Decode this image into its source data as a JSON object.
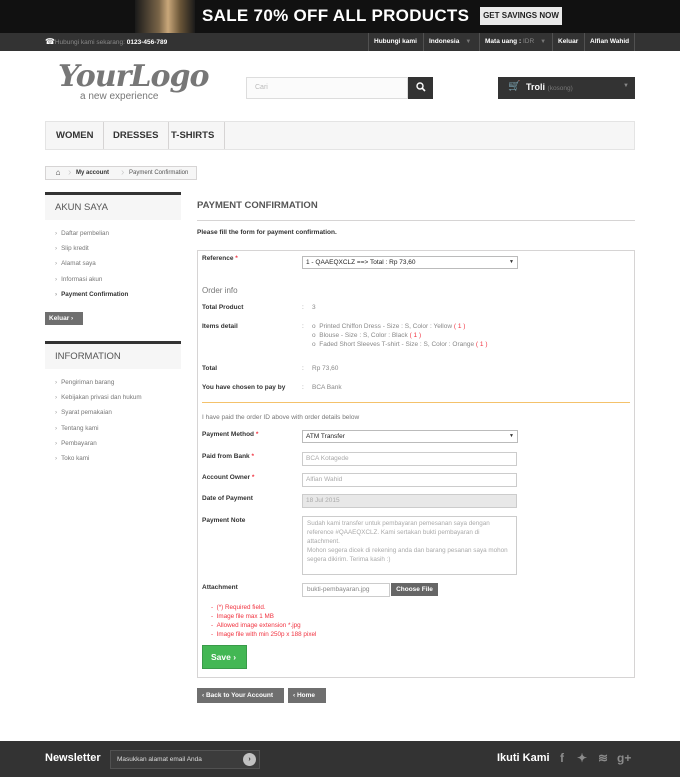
{
  "banner": {
    "sale_text": "SALE 70% OFF ALL PRODUCTS",
    "cta_label": "GET SAVINGS NOW"
  },
  "topbar": {
    "phone_label": "Hubungi kami sekarang:",
    "phone_number": "0123-456-789",
    "contact_link": "Hubungi kami",
    "language": "Indonesia",
    "currency_label": "Mata uang :",
    "currency_value": "IDR",
    "logout": "Keluar",
    "user_name": "Alfian Wahid"
  },
  "header": {
    "logo_text": "YourLogo",
    "logo_tagline": "a new experience",
    "search_placeholder": "Cari",
    "cart_label": "Troli",
    "cart_status": "(kosong)"
  },
  "menu": {
    "items": [
      "WOMEN",
      "DRESSES",
      "T-SHIRTS"
    ]
  },
  "breadcrumb": {
    "items": [
      "My account",
      "Payment Confirmation"
    ]
  },
  "sidebar": {
    "account_title": "AKUN SAYA",
    "account_items": [
      "Daftar pembelian",
      "Slip kredit",
      "Alamat saya",
      "Informasi akun",
      "Payment Confirmation"
    ],
    "logout_label": "Keluar",
    "info_title": "INFORMATION",
    "info_items": [
      "Pengiriman barang",
      "Kebijakan privasi dan hukum",
      "Syarat pemakaian",
      "Tentang kami",
      "Pembayaran",
      "Toko kami"
    ]
  },
  "main": {
    "title": "PAYMENT CONFIRMATION",
    "intro": "Please fill the form for payment confirmation.",
    "reference_label": "Reference",
    "reference_value": "1 - QAAEQXCLZ ==> Total : Rp 73,60",
    "order_info": "Order info",
    "total_product_label": "Total Product",
    "total_product_value": "3",
    "items_detail_label": "Items detail",
    "items": [
      {
        "text": "Printed Chiffon Dress - Size : S, Color : Yellow",
        "qty": "( 1 )"
      },
      {
        "text": "Blouse - Size : S, Color : Black",
        "qty": "( 1 )"
      },
      {
        "text": "Faded Short Sleeves T-shirt - Size : S, Color : Orange",
        "qty": "( 1 )"
      }
    ],
    "total_label": "Total",
    "total_value": "Rp 73,60",
    "pay_by_label": "You have chosen to pay by",
    "pay_by_value": "BCA Bank",
    "paid_note": "I have paid the order ID above with order details below",
    "payment_method_label": "Payment Method",
    "payment_method_value": "ATM Transfer",
    "paid_from_bank_label": "Paid from Bank",
    "paid_from_bank_value": "BCA Kotagede",
    "account_owner_label": "Account Owner",
    "account_owner_value": "Alfian Wahid",
    "date_label": "Date of Payment",
    "date_value": "18 Jul 2015",
    "note_label": "Payment Note",
    "note_value": "Sudah kami transfer untuk pembayaran pemesanan saya dengan reference #QAAEQXCLZ. Kami sertakan bukti pembayaran di attachment.\nMohon segera dicek di rekening anda dan barang pesanan saya mohon segera dikirim. Terima kasih :)",
    "attachment_label": "Attachment",
    "attachment_file": "bukti-pembayaran.jpg",
    "choose_file": "Choose File",
    "rules": [
      "(*) Required field.",
      "Image file max 1 MB",
      "Allowed image extension *.jpg",
      "Image file with min 250p x 188 pixel"
    ],
    "save_label": "Save",
    "back_label": "Back to Your Account",
    "home_label": "Home"
  },
  "footer": {
    "newsletter_title": "Newsletter",
    "newsletter_placeholder": "Masukkan alamat email Anda",
    "follow_title": "Ikuti Kami"
  }
}
